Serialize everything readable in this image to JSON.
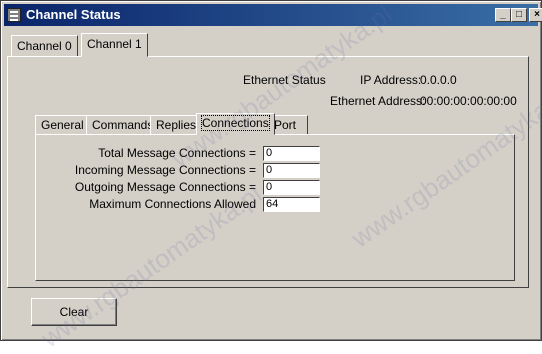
{
  "window": {
    "title": "Channel Status"
  },
  "channel_tabs": [
    {
      "label": "Channel 0",
      "active": false
    },
    {
      "label": "Channel 1",
      "active": true
    }
  ],
  "ethernet": {
    "status_label": "Ethernet Status",
    "ip_label": "IP Address:",
    "ip_value": "0.0.0.0",
    "mac_label": "Ethernet Address:",
    "mac_value": "00:00:00:00:00:00"
  },
  "sub_tabs": [
    {
      "label": "General",
      "active": false
    },
    {
      "label": "Commands",
      "active": false
    },
    {
      "label": "Replies",
      "active": false
    },
    {
      "label": "Connections",
      "active": true
    },
    {
      "label": "Port",
      "active": false
    }
  ],
  "connections": {
    "fields": [
      {
        "label": "Total Message Connections =",
        "value": "0"
      },
      {
        "label": "Incoming Message Connections =",
        "value": "0"
      },
      {
        "label": "Outgoing Message Connections =",
        "value": "0"
      },
      {
        "label": "Maximum Connections Allowed",
        "value": "64"
      }
    ]
  },
  "actions": {
    "clear_label": "Clear"
  },
  "watermark": {
    "text": "www.rgbautomatyka.pl"
  }
}
